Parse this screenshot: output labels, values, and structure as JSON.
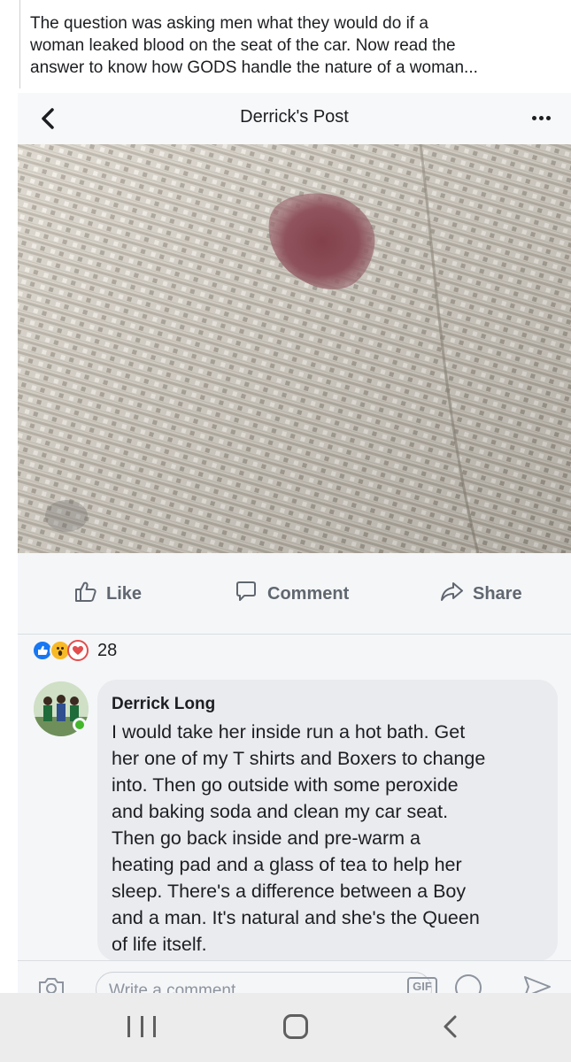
{
  "caption": {
    "lines": [
      "The question was asking men what they would do if a",
      "woman leaked blood on the seat of the car. Now read the",
      "answer to know how GODS handle the nature of a woman..."
    ]
  },
  "header": {
    "title": "Derrick's Post",
    "back_icon": "chevron-left-icon",
    "more_icon": "more-dots-icon"
  },
  "photo": {
    "subject": "car seat fabric with stain",
    "colors": {
      "fabric": "#d8d2c8",
      "stain": "#8a3b46"
    }
  },
  "actions": {
    "like": "Like",
    "comment": "Comment",
    "share": "Share"
  },
  "reactions": {
    "types": [
      "like",
      "wow",
      "love"
    ],
    "count": "28"
  },
  "comment": {
    "author": "Derrick Long",
    "online": true,
    "lines": [
      "I would take her inside run a hot bath. Get",
      "her one of my T shirts and Boxers to change",
      "into. Then go outside with some peroxide",
      "and baking soda and clean my car seat.",
      "Then go back inside and pre-warm a",
      "heating pad and a glass of tea to help her",
      "sleep. There's a difference between a Boy",
      "and a man. It's natural and she's the Queen",
      "of life itself."
    ]
  },
  "composer": {
    "placeholder": "Write a comment...",
    "gif_label": "GIF"
  },
  "colors": {
    "accent": "#1877f2",
    "online": "#42b72a",
    "text": "#1c1e21",
    "muted": "#606770"
  }
}
